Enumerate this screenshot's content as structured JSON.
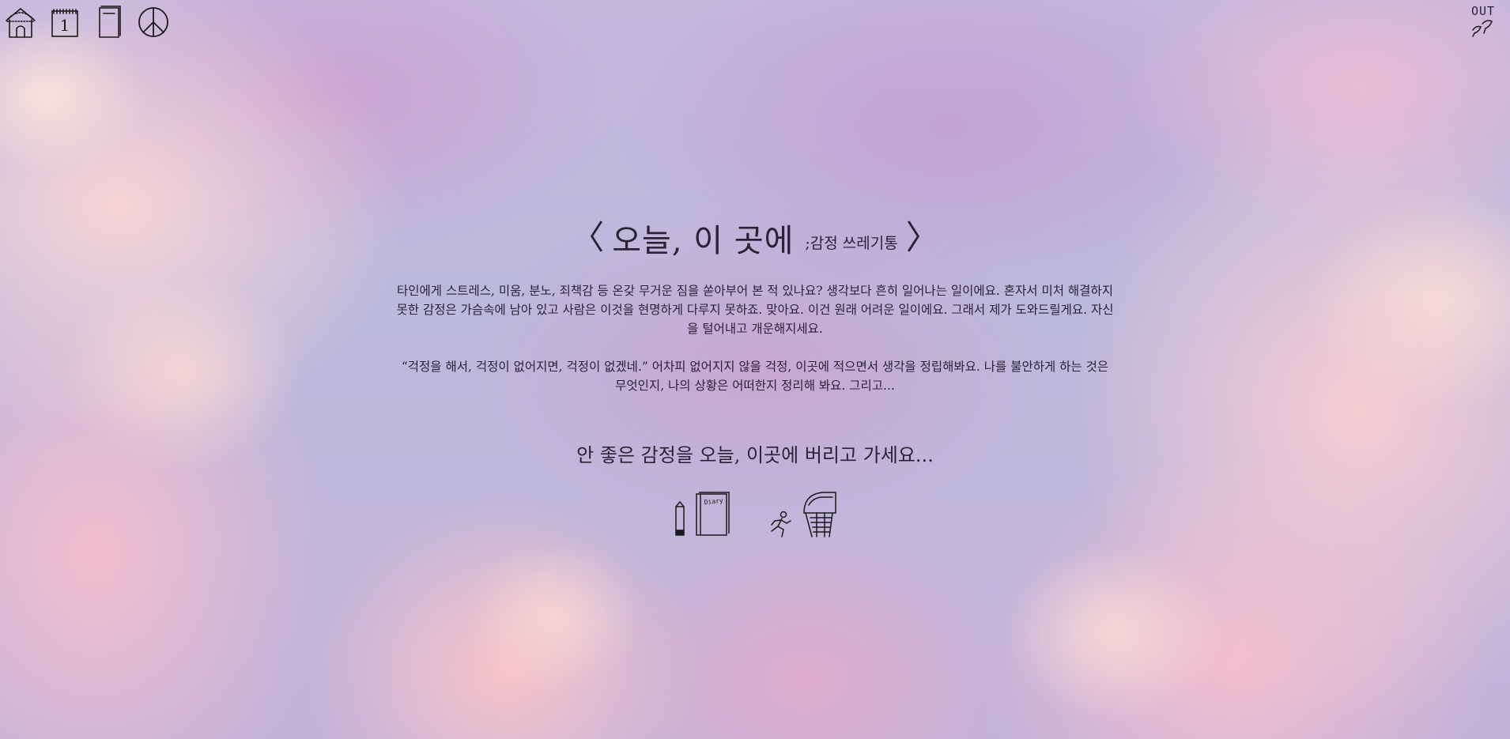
{
  "nav": {
    "items": [
      {
        "icon": "house-icon",
        "label": "home"
      },
      {
        "icon": "calendar-icon",
        "label": "calendar",
        "day": "1"
      },
      {
        "icon": "notebook-icon",
        "label": "notes"
      },
      {
        "icon": "peace-icon",
        "label": "peace"
      }
    ],
    "out": {
      "label": "OUT",
      "icon": "walking-feet-icon"
    }
  },
  "main": {
    "bracket_left": "〈",
    "bracket_right": "〉",
    "title": "오늘, 이 곳에",
    "subtitle": ";감정 쓰레기통",
    "paragraph1": "타인에게 스트레스, 미움, 분노, 죄책감 등 온갖 무거운 짐을 쏟아부어 본 적 있나요? 생각보다 흔히 일어나는 일이에요. 혼자서 미처 해결하지 못한 감정은 가슴속에 남아 있고 사람은 이것을 현명하게 다루지 못하죠. 맞아요. 이건 원래 어려운 일이에요. 그래서 제가 도와드릴게요. 자신을 털어내고 개운해지세요.",
    "paragraph2": "“걱정을 해서, 걱정이 없어지면, 걱정이 없겠네.” 어차피 없어지지 않을 걱정, 이곳에 적으면서 생각을 정립해봐요. 나를 불안하게 하는 것은 무엇인지, 나의 상황은 어떠한지 정리해 봐요. 그리고...",
    "tagline": "안 좋은 감정을 오늘, 이곳에 버리고 가세요...",
    "diary_label": "Diary"
  },
  "colors": {
    "sky_base": "#bcbadc",
    "text": "#2a2235",
    "cloud_pink": "#f5bece",
    "cloud_peach": "#fad6d6"
  }
}
